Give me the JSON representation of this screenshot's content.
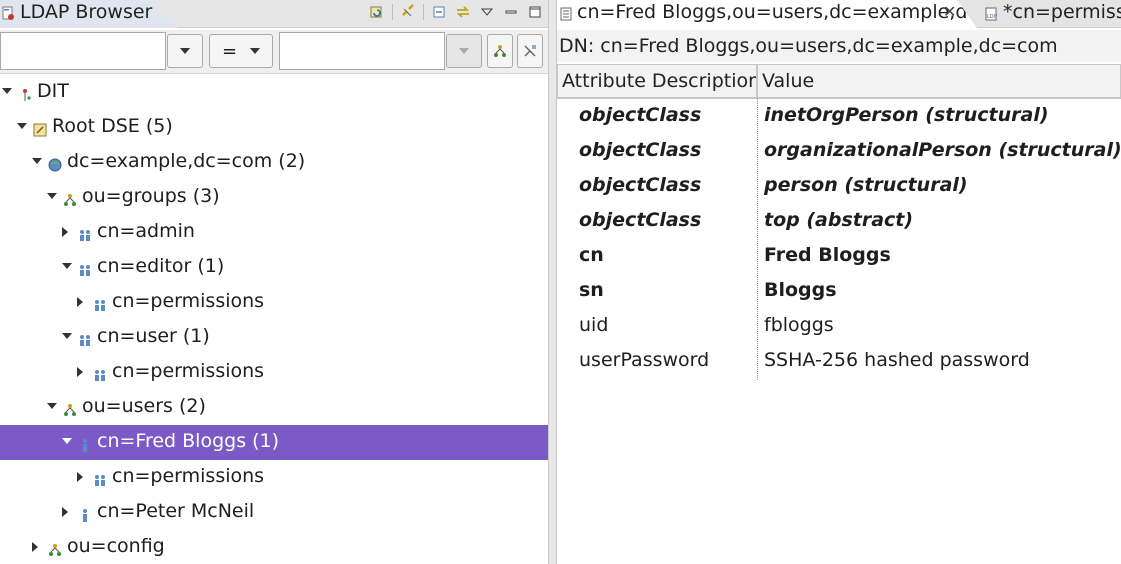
{
  "browser": {
    "title": "LDAP Browser",
    "filter": {
      "attribute_value": "",
      "operator": "=",
      "value": ""
    },
    "tree": [
      {
        "label": "DIT",
        "icon": "dit-icon",
        "level": 0,
        "state": "open"
      },
      {
        "label": "Root DSE (5)",
        "icon": "root-dse-icon",
        "level": 1,
        "state": "open"
      },
      {
        "label": "dc=example,dc=com (2)",
        "icon": "globe-icon",
        "level": 2,
        "state": "open"
      },
      {
        "label": "ou=groups (3)",
        "icon": "ou-icon",
        "level": 3,
        "state": "open"
      },
      {
        "label": "cn=admin",
        "icon": "group-icon",
        "level": 4,
        "state": "closed"
      },
      {
        "label": "cn=editor (1)",
        "icon": "group-icon",
        "level": 4,
        "state": "open"
      },
      {
        "label": "cn=permissions",
        "icon": "group-icon",
        "level": 5,
        "state": "closed"
      },
      {
        "label": "cn=user (1)",
        "icon": "group-icon",
        "level": 4,
        "state": "open"
      },
      {
        "label": "cn=permissions",
        "icon": "group-icon",
        "level": 5,
        "state": "closed"
      },
      {
        "label": "ou=users (2)",
        "icon": "ou-icon",
        "level": 3,
        "state": "open"
      },
      {
        "label": "cn=Fred Bloggs (1)",
        "icon": "person-icon",
        "level": 4,
        "state": "open",
        "selected": true
      },
      {
        "label": "cn=permissions",
        "icon": "group-icon",
        "level": 5,
        "state": "closed"
      },
      {
        "label": "cn=Peter McNeil",
        "icon": "person-icon",
        "level": 4,
        "state": "closed"
      },
      {
        "label": "ou=config",
        "icon": "ou-icon",
        "level": 2,
        "state": "closed"
      }
    ]
  },
  "editor": {
    "tabs": [
      {
        "label": "cn=Fred Bloggs,ou=users,dc=example,d",
        "active": true
      },
      {
        "label": "*cn=permissi",
        "active": false
      }
    ],
    "dn": "DN: cn=Fred Bloggs,ou=users,dc=example,dc=com",
    "columns": [
      "Attribute Description",
      "Value"
    ],
    "rows": [
      {
        "attr": "objectClass",
        "value": "inetOrgPerson (structural)",
        "style": "bi"
      },
      {
        "attr": "objectClass",
        "value": "organizationalPerson (structural)",
        "style": "bi"
      },
      {
        "attr": "objectClass",
        "value": "person (structural)",
        "style": "bi"
      },
      {
        "attr": "objectClass",
        "value": "top (abstract)",
        "style": "bi"
      },
      {
        "attr": "cn",
        "value": "Fred Bloggs",
        "style": "b"
      },
      {
        "attr": "sn",
        "value": "Bloggs",
        "style": "b"
      },
      {
        "attr": "uid",
        "value": "fbloggs",
        "style": ""
      },
      {
        "attr": "userPassword",
        "value": "SSHA-256 hashed password",
        "style": ""
      }
    ]
  },
  "colors": {
    "selection": "#7b5ac8",
    "tab_active": "#dfe6f0"
  }
}
